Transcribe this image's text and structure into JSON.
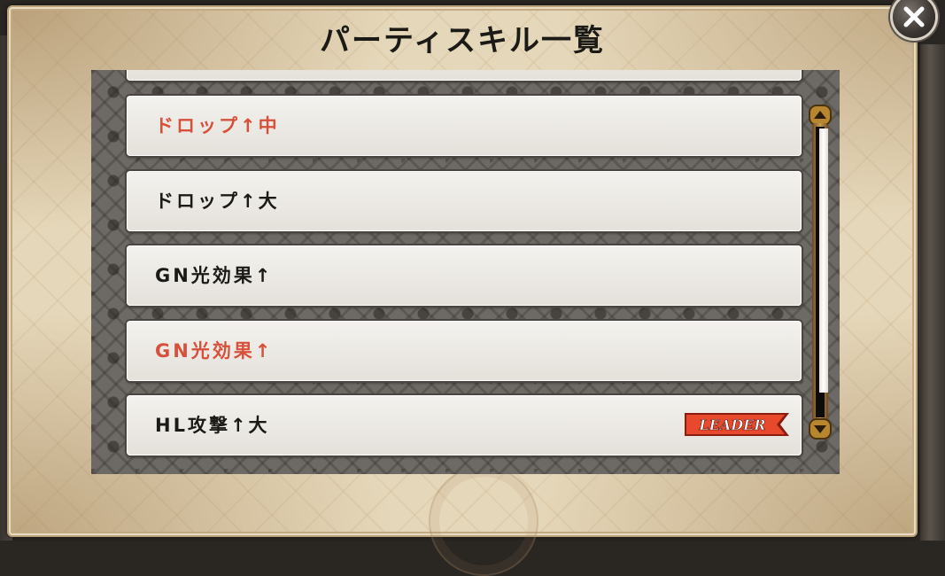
{
  "dialog": {
    "title": "パーティスキル一覧",
    "close_icon": "close-x-icon"
  },
  "skills": [
    {
      "name": "",
      "color": "#1c1a17",
      "leader": false
    },
    {
      "name": "ドロップ↑中",
      "color": "#d9503a",
      "leader": false
    },
    {
      "name": "ドロップ↑大",
      "color": "#1c1a17",
      "leader": false
    },
    {
      "name": "GN光効果↑",
      "color": "#1c1a17",
      "leader": false
    },
    {
      "name": "GN光効果↑",
      "color": "#d9503a",
      "leader": false
    },
    {
      "name": "HL攻撃↑大",
      "color": "#1c1a17",
      "leader": true
    }
  ],
  "leader_badge": {
    "label": "LEADER",
    "fill": "#e8482c",
    "text_color": "#ffffff"
  },
  "scrollbar": {
    "up_icon": "chevron-up-icon",
    "down_icon": "chevron-down-icon",
    "position": 0.08,
    "visible_fraction": 0.91
  },
  "colors": {
    "parchment": "#e5d7b9",
    "panel": "#6d6964",
    "highlight_text": "#d9503a",
    "normal_text": "#1c1a17"
  }
}
